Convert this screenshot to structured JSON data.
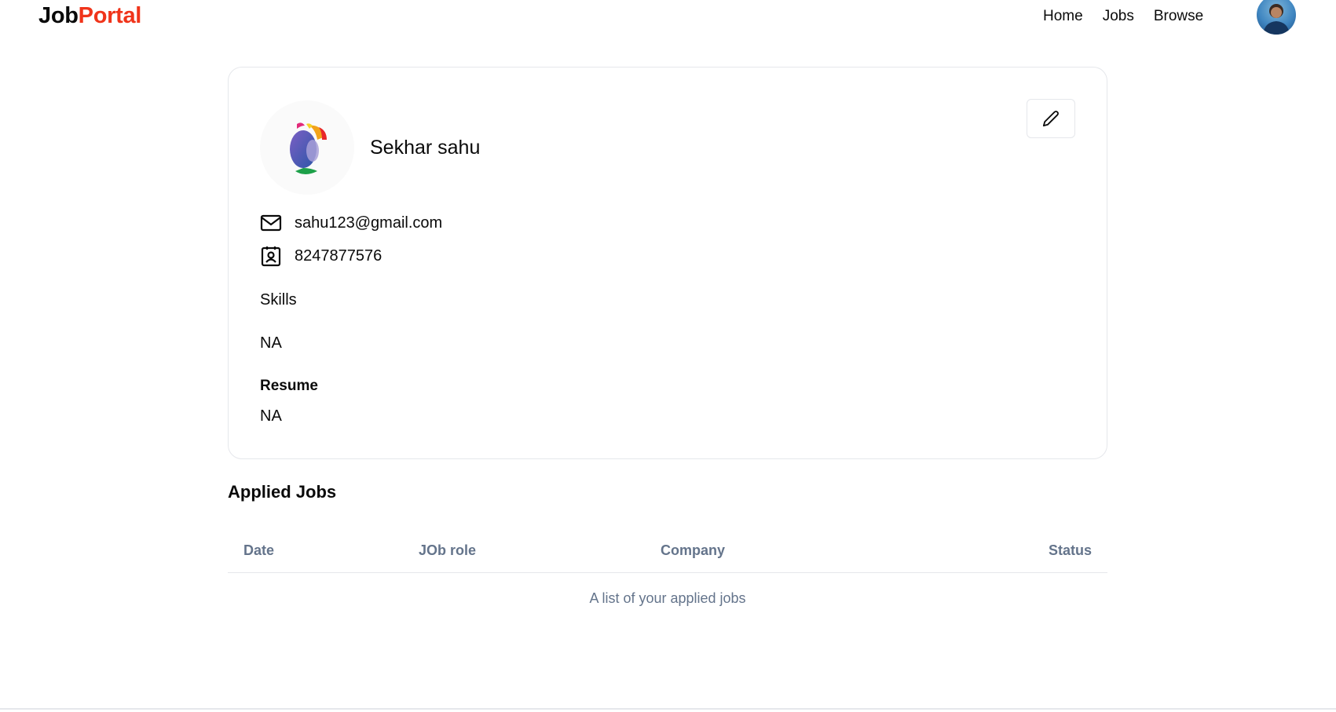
{
  "navbar": {
    "brand_part1": "Job",
    "brand_part2": "Portal",
    "links": [
      "Home",
      "Jobs",
      "Browse"
    ]
  },
  "profile": {
    "name": "Sekhar sahu",
    "email": "sahu123@gmail.com",
    "phone": "8247877576",
    "skills_label": "Skills",
    "skills_value": "NA",
    "resume_label": "Resume",
    "resume_value": "NA"
  },
  "applied_jobs": {
    "title": "Applied Jobs",
    "columns": [
      "Date",
      "JOb role",
      "Company",
      "Status"
    ],
    "caption": "A list of your applied jobs"
  },
  "colors": {
    "brand_accent": "#f0341a",
    "muted_text": "#64748b",
    "border": "#e5e7eb"
  },
  "icons": [
    "pencil-icon",
    "mail-icon",
    "contact-icon",
    "company-logo",
    "user-avatar"
  ]
}
